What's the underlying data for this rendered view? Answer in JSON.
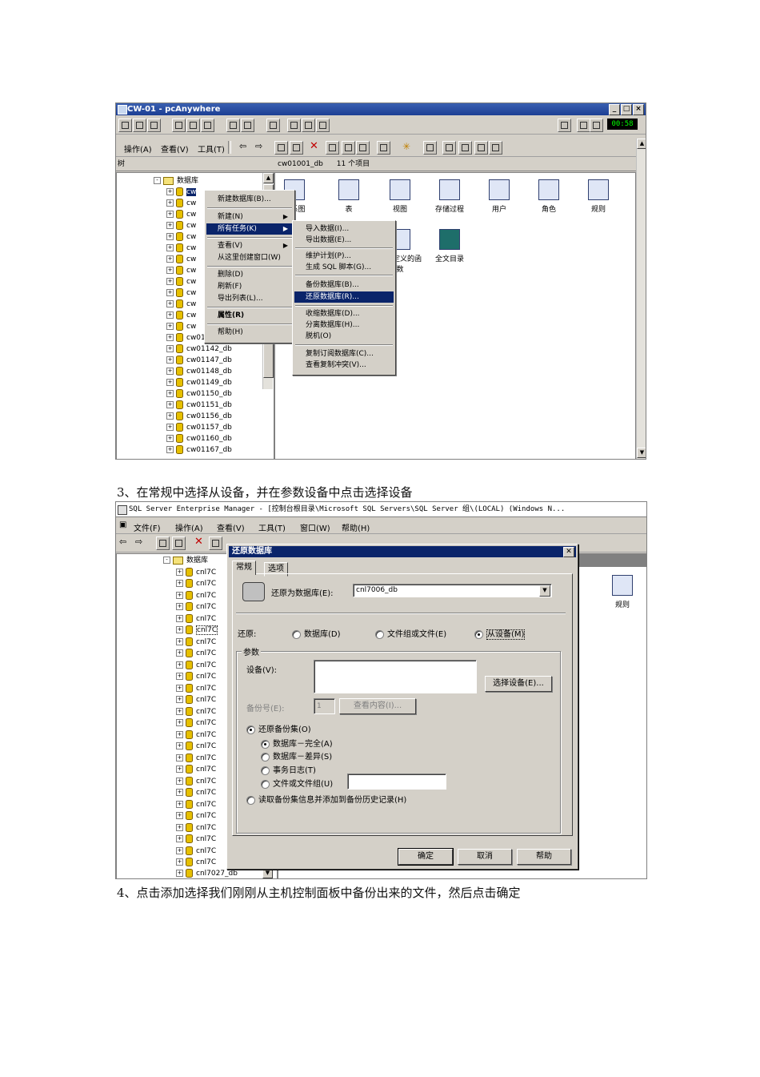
{
  "shot1": {
    "window_title": "CW-01 - pcAnywhere",
    "clock": "00:58",
    "menu": [
      "操作(A)",
      "查看(V)",
      "工具(T)"
    ],
    "tree_label": "树",
    "path": "cw01001_db",
    "item_count": "11 个项目",
    "tree_root": "数据库",
    "tree_partial": "cw",
    "tree_items": [
      "cw01133_db",
      "cw01142_db",
      "cw01147_db",
      "cw01148_db",
      "cw01149_db",
      "cw01150_db",
      "cw01151_db",
      "cw01156_db",
      "cw01157_db",
      "cw01160_db",
      "cw01167_db"
    ],
    "icons": [
      "关系图",
      "表",
      "视图",
      "存储过程",
      "用户",
      "角色",
      "规则",
      "用户定义的函数",
      "全文目录"
    ],
    "context_menu": [
      "新建数据库(B)...",
      "新建(N)",
      "所有任务(K)",
      "查看(V)",
      "从这里创建窗口(W)",
      "删除(D)",
      "刷新(F)",
      "导出列表(L)...",
      "属性(R)",
      "帮助(H)"
    ],
    "submenu": [
      "导入数据(I)...",
      "导出数据(E)...",
      "维护计划(P)...",
      "生成 SQL 脚本(G)...",
      "备份数据库(B)...",
      "还原数据库(R)...",
      "收缩数据库(D)...",
      "分离数据库(H)...",
      "脱机(O)",
      "复制订阅数据库(C)...",
      "查看复制冲突(V)..."
    ]
  },
  "caption3": "3、在常规中选择从设备，并在参数设备中点击选择设备",
  "shot2": {
    "window_title": "SQL Server Enterprise Manager - [控制台根目录\\Microsoft SQL Servers\\SQL Server 组\\(LOCAL) (Windows N...",
    "menu": [
      "文件(F)",
      "操作(A)",
      "查看(V)",
      "工具(T)",
      "窗口(W)",
      "帮助(H)"
    ],
    "tree_root": "数据库",
    "tree_partial": "cnl7C",
    "tree_last": "cnl7027_db",
    "right_icon": "规则",
    "dialog": {
      "title": "还原数据库",
      "tabs": [
        "常规",
        "选项"
      ],
      "restore_as_label": "还原为数据库(E):",
      "restore_as_value": "cnl7006_db",
      "restore_label": "还原:",
      "restore_options": [
        "数据库(D)",
        "文件组或文件(E)",
        "从设备(M)"
      ],
      "params_title": "参数",
      "device_label": "设备(V):",
      "select_device_btn": "选择设备(E)...",
      "backup_no_label": "备份号(E):",
      "backup_no_value": "1",
      "view_contents_btn": "查看内容(I)...",
      "restore_backup_set": "还原备份集(O)",
      "backup_types": [
        "数据库－完全(A)",
        "数据库－差异(S)",
        "事务日志(T)",
        "文件或文件组(U)"
      ],
      "read_backup_info": "读取备份集信息并添加到备份历史记录(H)",
      "buttons": [
        "确定",
        "取消",
        "帮助"
      ]
    }
  },
  "caption4": "4、点击添加选择我们刚刚从主机控制面板中备份出来的文件，然后点击确定"
}
